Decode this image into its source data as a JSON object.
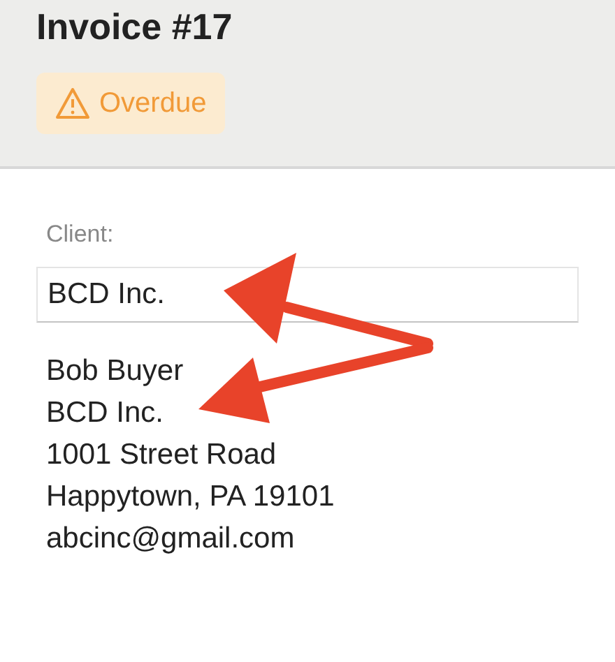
{
  "header": {
    "title": "Invoice #17",
    "status_badge": {
      "label": "Overdue"
    }
  },
  "client": {
    "label": "Client:",
    "value": "BCD Inc.",
    "address": [
      "Bob Buyer",
      "BCD Inc.",
      "1001 Street Road",
      "Happytown, PA 19101",
      "abcinc@gmail.com"
    ]
  }
}
